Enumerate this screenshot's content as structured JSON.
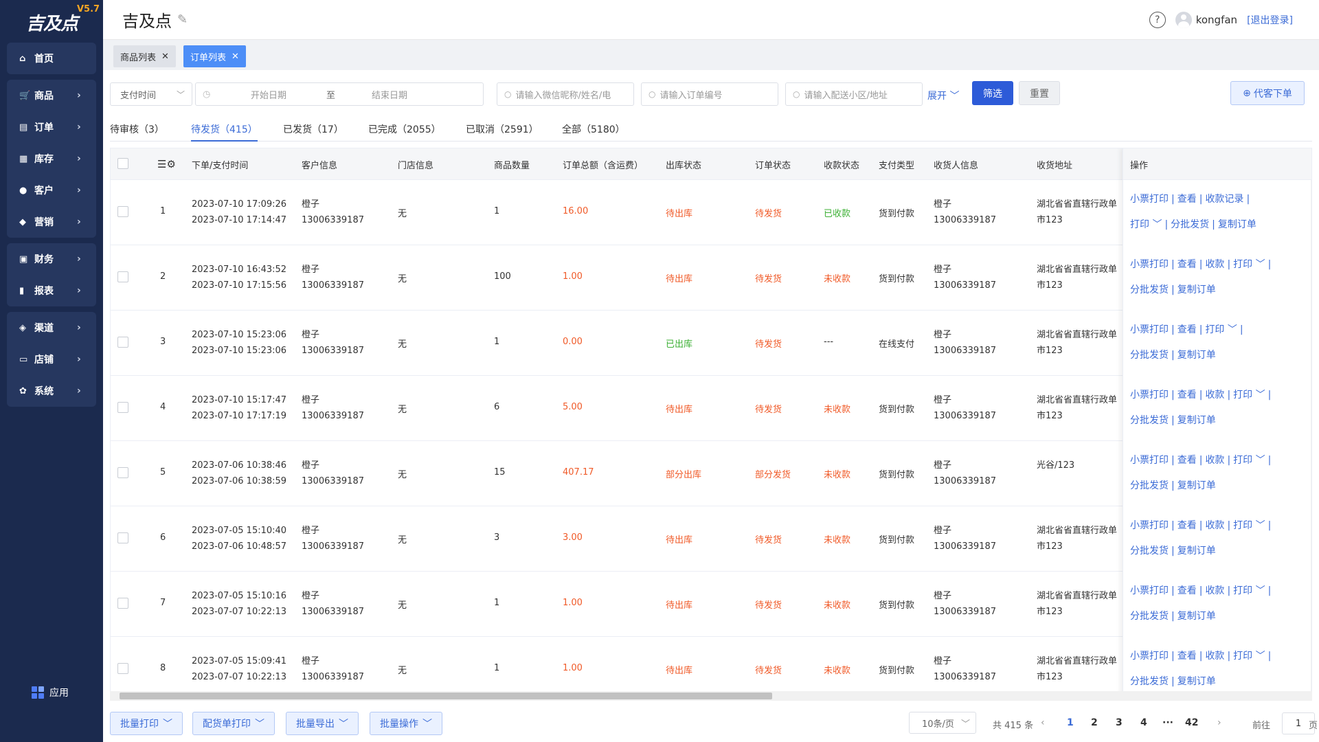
{
  "app": {
    "logo_text": "吉及点",
    "version": "V5.7"
  },
  "sidebar": {
    "groups": [
      [
        {
          "label": "首页",
          "icon": "home-icon",
          "glyph": "⌂",
          "arrow": false
        }
      ],
      [
        {
          "label": "商品",
          "icon": "cart-icon",
          "glyph": "🛒",
          "arrow": true
        },
        {
          "label": "订单",
          "icon": "order-icon",
          "glyph": "▤",
          "arrow": true
        },
        {
          "label": "库存",
          "icon": "stock-icon",
          "glyph": "▦",
          "arrow": true
        },
        {
          "label": "客户",
          "icon": "customer-icon",
          "glyph": "●",
          "arrow": true
        },
        {
          "label": "营销",
          "icon": "tag-icon",
          "glyph": "◆",
          "arrow": true
        }
      ],
      [
        {
          "label": "财务",
          "icon": "finance-icon",
          "glyph": "▣",
          "arrow": true
        },
        {
          "label": "报表",
          "icon": "report-icon",
          "glyph": "▮",
          "arrow": true
        }
      ],
      [
        {
          "label": "渠道",
          "icon": "channel-icon",
          "glyph": "◈",
          "arrow": true
        },
        {
          "label": "店铺",
          "icon": "shop-icon",
          "glyph": "▭",
          "arrow": true
        },
        {
          "label": "系统",
          "icon": "system-icon",
          "glyph": "✿",
          "arrow": true
        }
      ]
    ],
    "app_label": "应用"
  },
  "header": {
    "title": "吉及点",
    "username": "kongfan",
    "logout": "[退出登录]"
  },
  "page_tabs": [
    {
      "label": "商品列表"
    },
    {
      "label": "订单列表"
    }
  ],
  "filters": {
    "time_select": "支付时间",
    "start_date": "开始日期",
    "to": "至",
    "end_date": "结束日期",
    "customer_placeholder": "请输入微信昵称/姓名/电",
    "order_placeholder": "请输入订单编号",
    "address_placeholder": "请输入配送小区/地址",
    "expand": "展开",
    "filter_btn": "筛选",
    "reset_btn": "重置",
    "agent_btn": "代客下单"
  },
  "status_tabs": [
    {
      "label": "待审核（3）"
    },
    {
      "label": "待发货（415）"
    },
    {
      "label": "已发货（17）"
    },
    {
      "label": "已完成（2055）"
    },
    {
      "label": "已取消（2591）"
    },
    {
      "label": "全部（5180）"
    }
  ],
  "columns": [
    "下单/支付时间",
    "客户信息",
    "门店信息",
    "商品数量",
    "订单总额（含运费）",
    "出库状态",
    "订单状态",
    "收款状态",
    "支付类型",
    "收货人信息",
    "收货地址",
    "操作"
  ],
  "orders": [
    {
      "idx": "1",
      "time1": "2023-07-10 17:09:26",
      "time2": "2023-07-10 17:14:47",
      "cust_name": "橙子",
      "cust_phone": "13006339187",
      "store": "无",
      "qty": "1",
      "amount": "16.00",
      "out_status": "待出库",
      "order_status": "待发货",
      "pay_status": "已收款",
      "pay_type": "货到付款",
      "recv_name": "橙子",
      "recv_phone": "13006339187",
      "addr1": "湖北省省直辖行政单",
      "addr2": "市123",
      "ops1": [
        "小票打印",
        "查看",
        "收款记录",
        ""
      ],
      "ops2": [
        "打印 ﹀",
        "分批发货",
        "复制订单"
      ]
    },
    {
      "idx": "2",
      "time1": "2023-07-10 16:43:52",
      "time2": "2023-07-10 17:15:56",
      "cust_name": "橙子",
      "cust_phone": "13006339187",
      "store": "无",
      "qty": "100",
      "amount": "1.00",
      "out_status": "待出库",
      "order_status": "待发货",
      "pay_status": "未收款",
      "pay_type": "货到付款",
      "recv_name": "橙子",
      "recv_phone": "13006339187",
      "addr1": "湖北省省直辖行政单",
      "addr2": "市123",
      "ops1": [
        "小票打印",
        "查看",
        "收款",
        "打印 ﹀",
        ""
      ],
      "ops2": [
        "分批发货",
        "复制订单"
      ]
    },
    {
      "idx": "3",
      "time1": "2023-07-10 15:23:06",
      "time2": "2023-07-10 15:23:06",
      "cust_name": "橙子",
      "cust_phone": "13006339187",
      "store": "无",
      "qty": "1",
      "amount": "0.00",
      "out_status": "已出库",
      "order_status": "待发货",
      "pay_status": "---",
      "pay_type": "在线支付",
      "recv_name": "橙子",
      "recv_phone": "13006339187",
      "addr1": "湖北省省直辖行政单",
      "addr2": "市123",
      "ops1": [
        "小票打印",
        "查看",
        "打印 ﹀",
        ""
      ],
      "ops2": [
        "分批发货",
        "复制订单"
      ]
    },
    {
      "idx": "4",
      "time1": "2023-07-10 15:17:47",
      "time2": "2023-07-10 17:17:19",
      "cust_name": "橙子",
      "cust_phone": "13006339187",
      "store": "无",
      "qty": "6",
      "amount": "5.00",
      "out_status": "待出库",
      "order_status": "待发货",
      "pay_status": "未收款",
      "pay_type": "货到付款",
      "recv_name": "橙子",
      "recv_phone": "13006339187",
      "addr1": "湖北省省直辖行政单",
      "addr2": "市123",
      "ops1": [
        "小票打印",
        "查看",
        "收款",
        "打印 ﹀",
        ""
      ],
      "ops2": [
        "分批发货",
        "复制订单"
      ]
    },
    {
      "idx": "5",
      "time1": "2023-07-06 10:38:46",
      "time2": "2023-07-06 10:38:59",
      "cust_name": "橙子",
      "cust_phone": "13006339187",
      "store": "无",
      "qty": "15",
      "amount": "407.17",
      "out_status": "部分出库",
      "order_status": "部分发货",
      "pay_status": "未收款",
      "pay_type": "货到付款",
      "recv_name": "橙子",
      "recv_phone": "13006339187",
      "addr1": "光谷/123",
      "addr2": "",
      "ops1": [
        "小票打印",
        "查看",
        "收款",
        "打印 ﹀",
        ""
      ],
      "ops2": [
        "分批发货",
        "复制订单"
      ]
    },
    {
      "idx": "6",
      "time1": "2023-07-05 15:10:40",
      "time2": "2023-07-06 10:48:57",
      "cust_name": "橙子",
      "cust_phone": "13006339187",
      "store": "无",
      "qty": "3",
      "amount": "3.00",
      "out_status": "待出库",
      "order_status": "待发货",
      "pay_status": "未收款",
      "pay_type": "货到付款",
      "recv_name": "橙子",
      "recv_phone": "13006339187",
      "addr1": "湖北省省直辖行政单",
      "addr2": "市123",
      "ops1": [
        "小票打印",
        "查看",
        "收款",
        "打印 ﹀",
        ""
      ],
      "ops2": [
        "分批发货",
        "复制订单"
      ]
    },
    {
      "idx": "7",
      "time1": "2023-07-05 15:10:16",
      "time2": "2023-07-07 10:22:13",
      "cust_name": "橙子",
      "cust_phone": "13006339187",
      "store": "无",
      "qty": "1",
      "amount": "1.00",
      "out_status": "待出库",
      "order_status": "待发货",
      "pay_status": "未收款",
      "pay_type": "货到付款",
      "recv_name": "橙子",
      "recv_phone": "13006339187",
      "addr1": "湖北省省直辖行政单",
      "addr2": "市123",
      "ops1": [
        "小票打印",
        "查看",
        "收款",
        "打印 ﹀",
        ""
      ],
      "ops2": [
        "分批发货",
        "复制订单"
      ]
    },
    {
      "idx": "8",
      "time1": "2023-07-05 15:09:41",
      "time2": "2023-07-07 10:22:13",
      "cust_name": "橙子",
      "cust_phone": "13006339187",
      "store": "无",
      "qty": "1",
      "amount": "1.00",
      "out_status": "待出库",
      "order_status": "待发货",
      "pay_status": "未收款",
      "pay_type": "货到付款",
      "recv_name": "橙子",
      "recv_phone": "13006339187",
      "addr1": "湖北省省直辖行政单",
      "addr2": "市123",
      "ops1": [
        "小票打印",
        "查看",
        "收款",
        "打印 ﹀",
        ""
      ],
      "ops2": [
        "分批发货",
        "复制订单"
      ]
    }
  ],
  "footer": {
    "batch_print": "批量打印",
    "picking_print": "配货单打印",
    "batch_export": "批量导出",
    "batch_ops": "批量操作",
    "page_size": "10条/页",
    "total": "共 415 条",
    "pages": [
      "1",
      "2",
      "3",
      "4",
      "···",
      "42"
    ],
    "current_page": "1",
    "goto_label": "前往",
    "goto_value": "1",
    "page_unit": "页"
  },
  "colors": {
    "accent": "#3b6bd6",
    "sidebar": "#1b2a4e",
    "warn": "#f05a28",
    "success": "#3cb034"
  }
}
